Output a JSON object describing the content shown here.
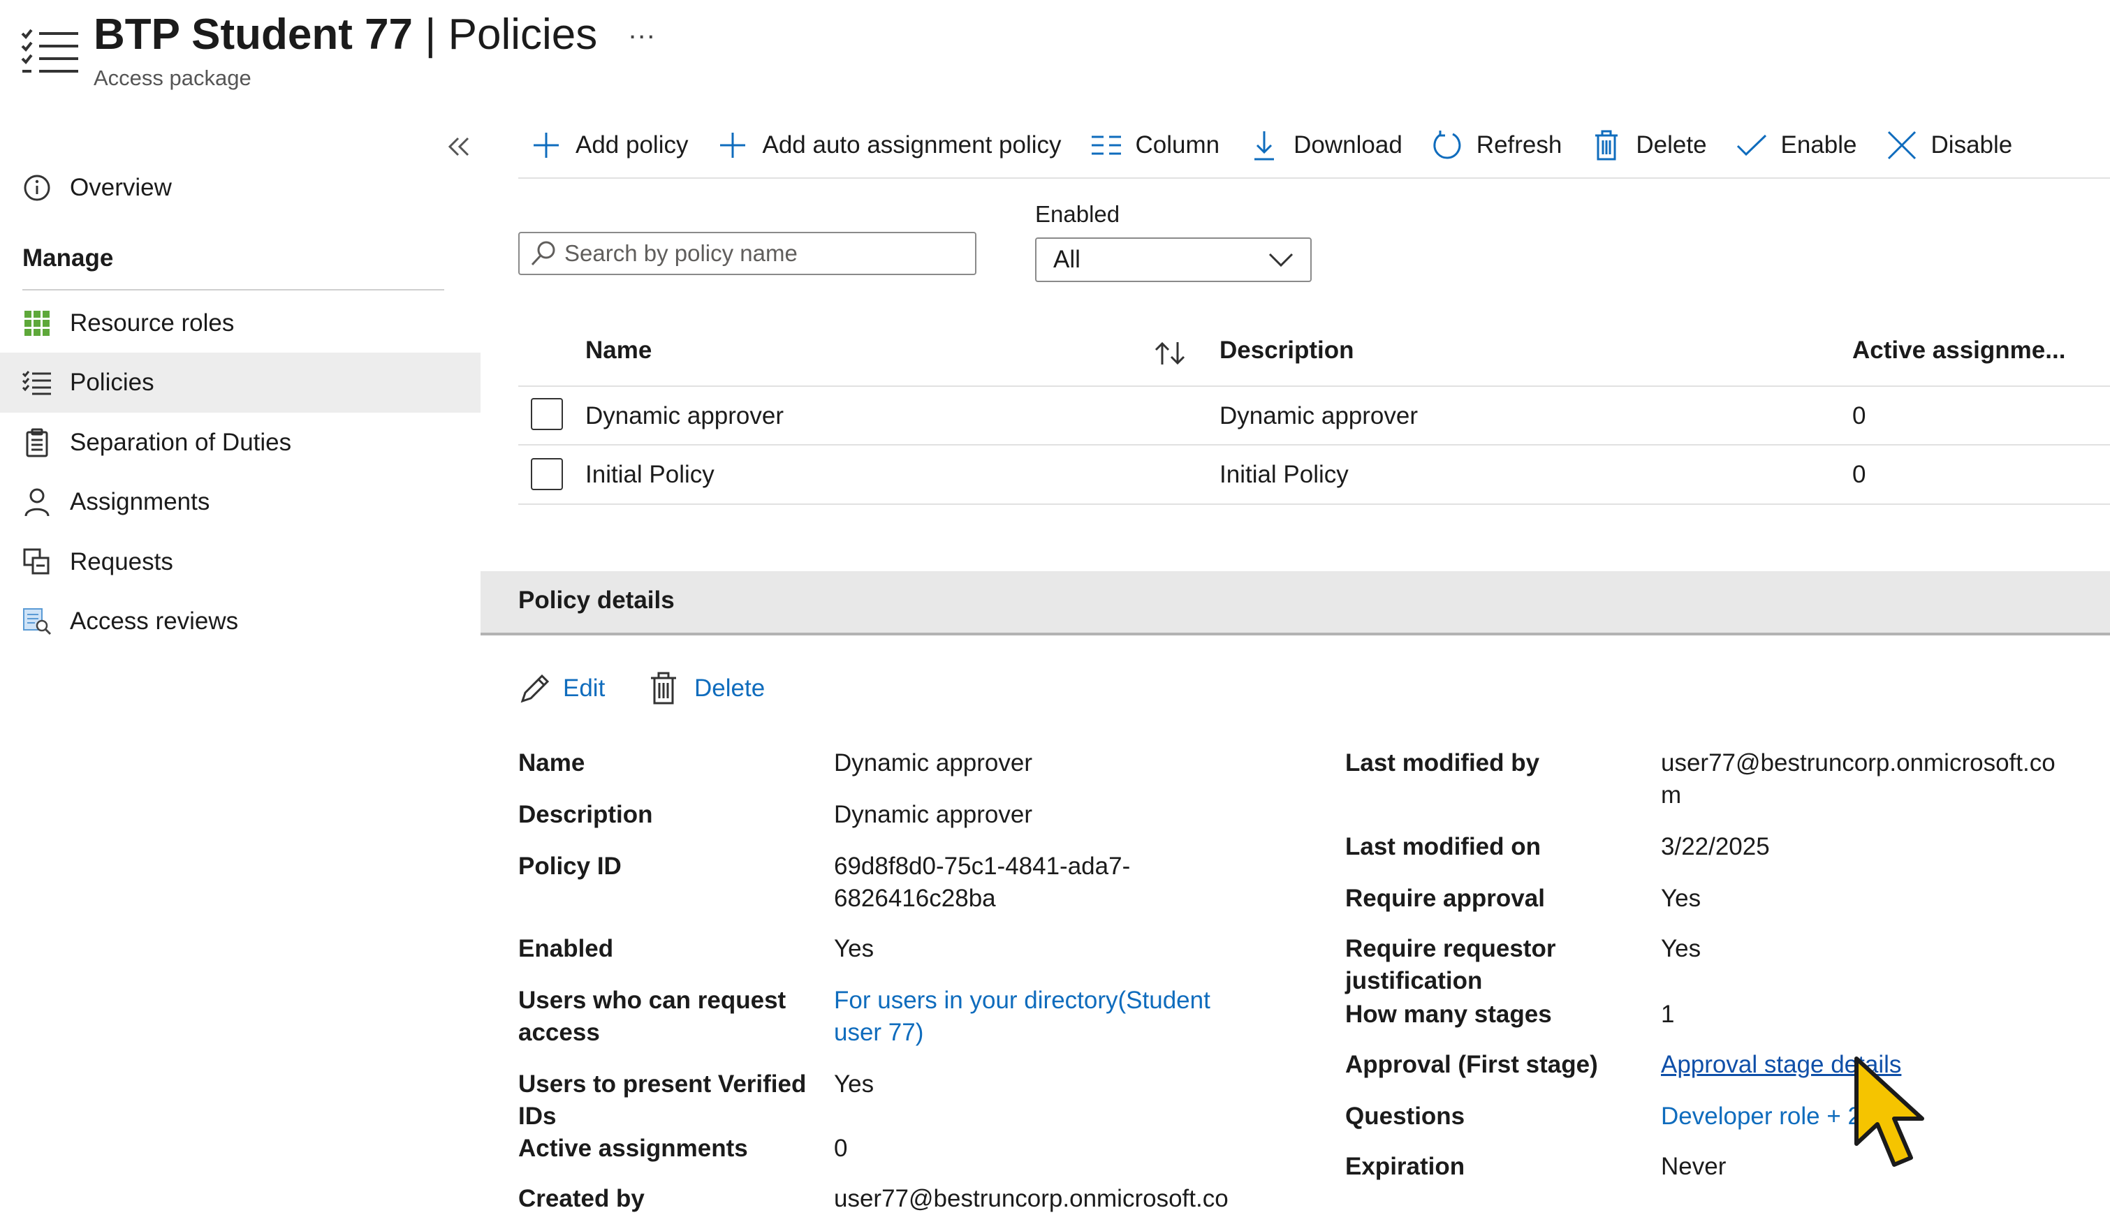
{
  "header": {
    "title_strong": "BTP Student 77",
    "title_rest": " | Policies",
    "more": "...",
    "subtitle": "Access package"
  },
  "sidebar": {
    "collapse_icon": "double-chevron-left-icon",
    "overview": "Overview",
    "manage_heading": "Manage",
    "items": [
      {
        "label": "Resource roles",
        "icon": "grid-icon"
      },
      {
        "label": "Policies",
        "icon": "list-check-icon"
      },
      {
        "label": "Separation of Duties",
        "icon": "clipboard-icon"
      },
      {
        "label": "Assignments",
        "icon": "person-icon"
      },
      {
        "label": "Requests",
        "icon": "requests-icon"
      },
      {
        "label": "Access reviews",
        "icon": "access-review-icon"
      }
    ],
    "active": "Policies"
  },
  "toolbar": {
    "add_policy": "Add policy",
    "add_auto": "Add auto assignment policy",
    "column": "Column",
    "download": "Download",
    "refresh": "Refresh",
    "delete": "Delete",
    "enable": "Enable",
    "disable": "Disable"
  },
  "filters": {
    "search_placeholder": "Search by policy name",
    "enabled_label": "Enabled",
    "enabled_value": "All"
  },
  "table": {
    "columns": [
      "Name",
      "Description",
      "Active assignme..."
    ],
    "rows": [
      {
        "name": "Dynamic approver",
        "description": "Dynamic approver",
        "active": "0"
      },
      {
        "name": "Initial Policy",
        "description": "Initial Policy",
        "active": "0"
      }
    ]
  },
  "details": {
    "title": "Policy details",
    "edit": "Edit",
    "delete": "Delete",
    "left": {
      "name_l": "Name",
      "name_v": "Dynamic approver",
      "desc_l": "Description",
      "desc_v": "Dynamic approver",
      "pid_l": "Policy ID",
      "pid_v1": "69d8f8d0-75c1-4841-ada7-",
      "pid_v2": "6826416c28ba",
      "enabled_l": "Enabled",
      "enabled_v": "Yes",
      "users_l1": "Users who can request",
      "users_l2": "access",
      "users_v1": "For users in your directory(Student",
      "users_v2": "user 77)",
      "vid_l1": "Users to present Verified",
      "vid_l2": "IDs",
      "vid_v": "Yes",
      "active_l": "Active assignments",
      "active_v": "0",
      "created_l": "Created by",
      "created_v": "user77@bestruncorp.onmicrosoft.co"
    },
    "right": {
      "lmb_l": "Last modified by",
      "lmb_v1": "user77@bestruncorp.onmicrosoft.co",
      "lmb_v2": "m",
      "lmo_l": "Last modified on",
      "lmo_v": "3/22/2025",
      "ra_l": "Require approval",
      "ra_v": "Yes",
      "rj_l1": "Require requestor",
      "rj_l2": "justification",
      "rj_v": "Yes",
      "hms_l": "How many stages",
      "hms_v": "1",
      "ap_l": "Approval (First stage)",
      "ap_v": "Approval stage details",
      "q_l": "Questions",
      "q_v": "Developer role + 2",
      "exp_l": "Expiration",
      "exp_v": "Never"
    }
  },
  "colors": {
    "link": "#0f6cbd",
    "cursor": "#f5c400",
    "active_bg": "#ededed"
  }
}
